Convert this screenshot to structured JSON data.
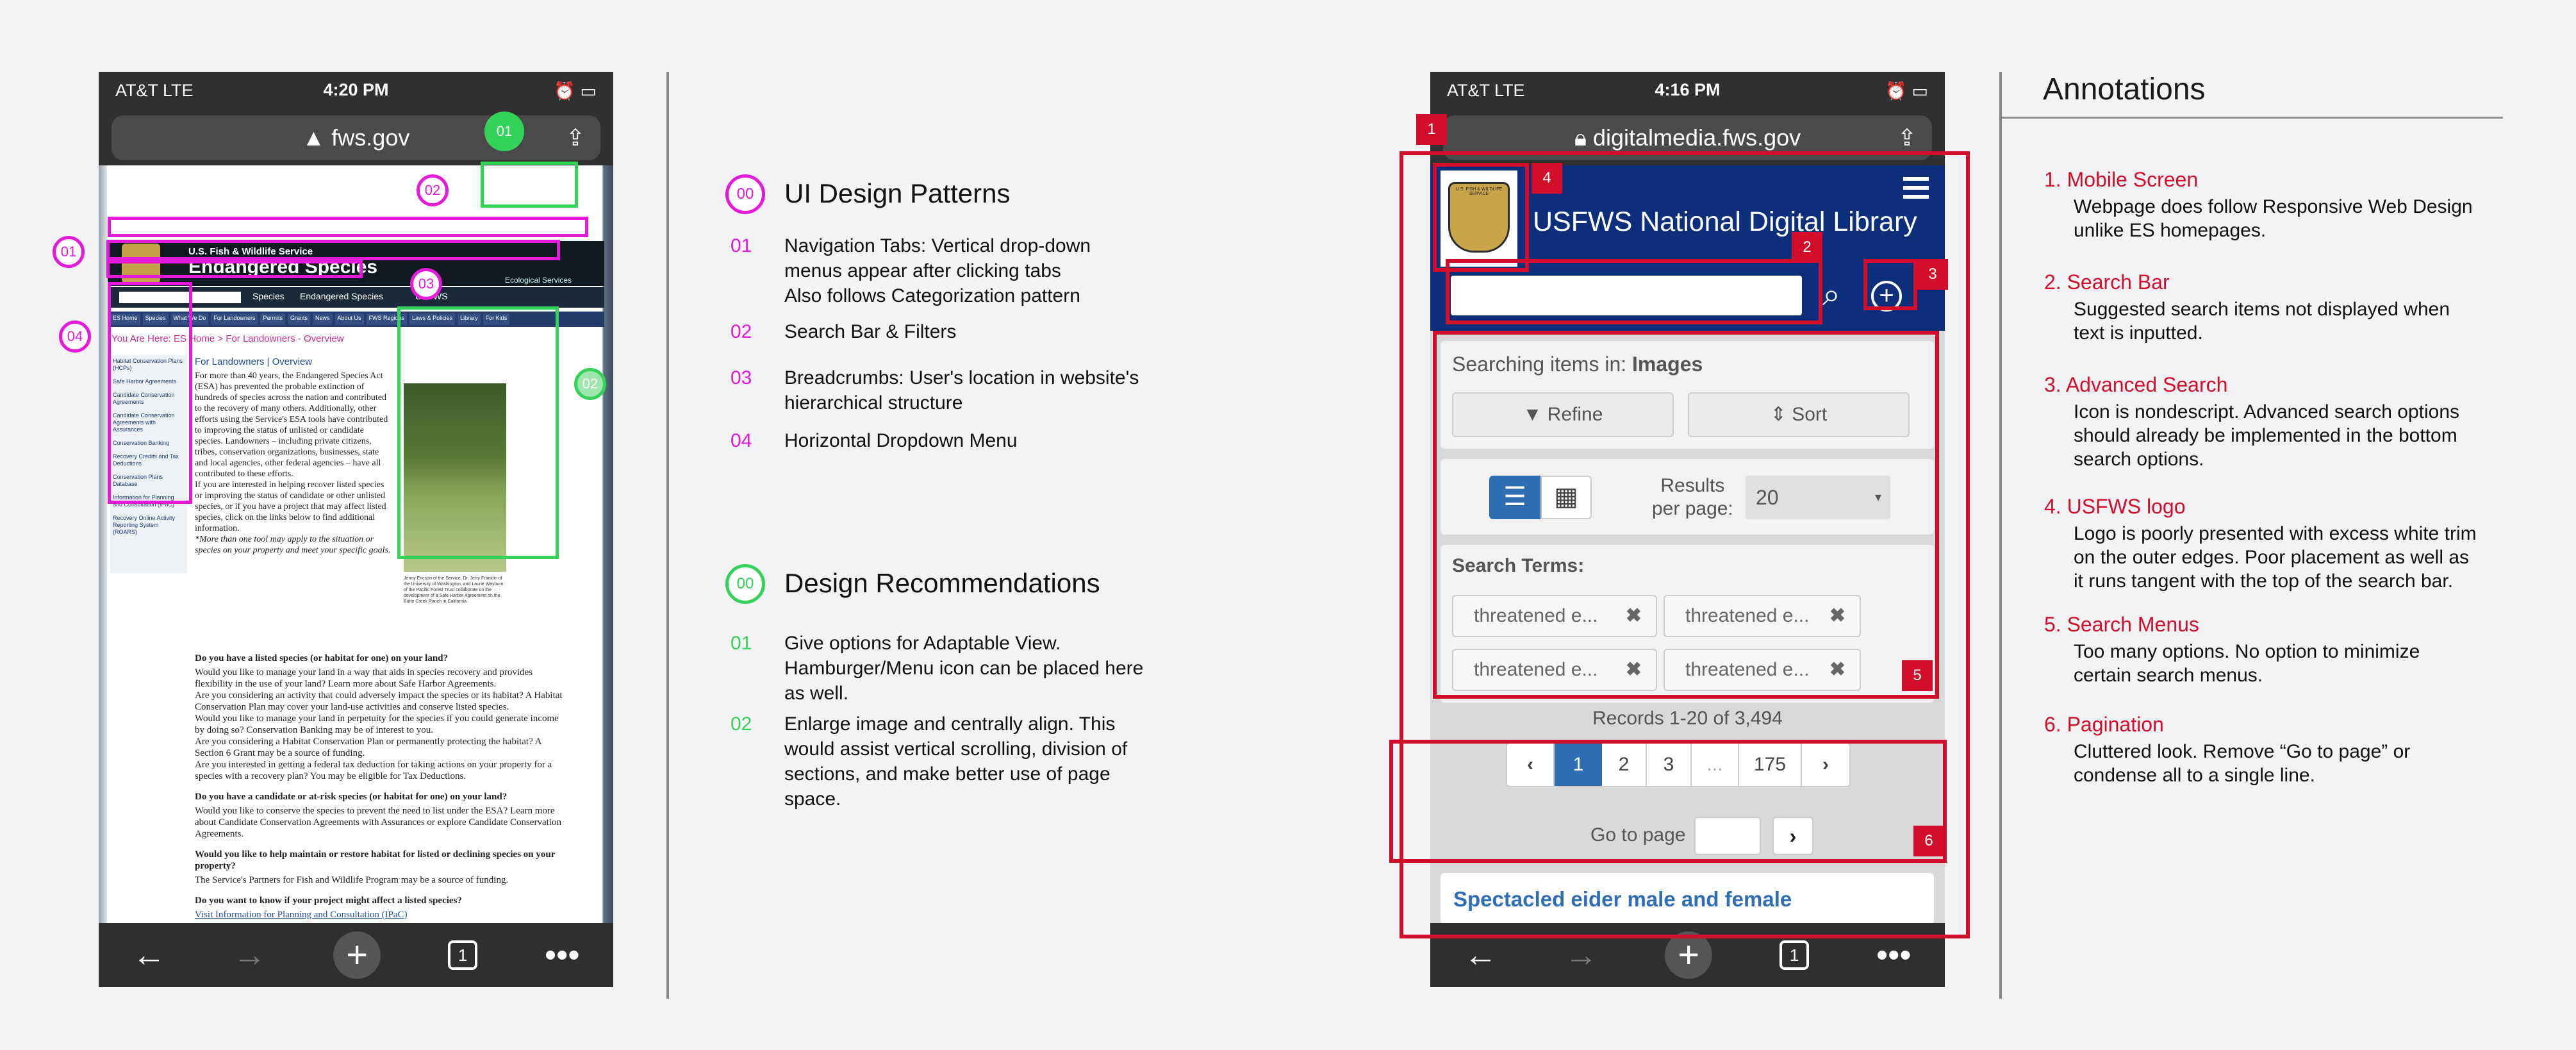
{
  "left_phone": {
    "carrier": "AT&T  LTE",
    "time": "4:20 PM",
    "url": "fws.gov",
    "banner_line1": "U.S. Fish & Wildlife Service",
    "banner_line2": "Endangered Species",
    "banner_right": "Ecological Services",
    "search_options": [
      "Species",
      "Endangered Species",
      "USFWS"
    ],
    "nav_tabs": [
      "ES Home",
      "Species",
      "What We Do",
      "For Landowners",
      "Permits",
      "Grants",
      "News",
      "About Us",
      "FWS Regions",
      "Laws & Policies",
      "Library",
      "For Kids"
    ],
    "breadcrumb": "You Are Here: ES Home > For Landowners - Overview",
    "sidebar_items": [
      "Habitat Conservation Plans (HCPs)",
      "Safe Harbor Agreements",
      "Candidate Conservation Agreements",
      "Candidate Conservation Agreements with Assurances",
      "Conservation Banking",
      "Recovery Credits and Tax Deductions",
      "Conservation Plans Database",
      "Information for Planning and Consultation (IPaC)",
      "Recovery Online Activity Reporting System (ROARS)"
    ],
    "page_heading": "For Landowners | Overview",
    "intro_1": "For more than 40 years, the Endangered Species Act (ESA) has prevented the probable extinction of hundreds of species across the nation and contributed to the recovery of many others. Additionally, other efforts using the Service's ESA tools have contributed to improving the status of unlisted or candidate species. Landowners – including private citizens, tribes, conservation organizations, businesses, state and local agencies, other federal agencies – have all contributed to these efforts.",
    "intro_2": "If you are interested in helping recover listed species or improving the status of candidate or other unlisted species, or if you have a project that may affect listed species, click on the links below to find additional information.",
    "intro_3": "*More than one tool may apply to the situation or species on your property and meet your specific goals.",
    "photo_caption": "Jenny Ericson of the Service, Dr. Jerry Franklin of the University of Washington, and Laurie Wayburn of the Pacific Forest Trust collaborate on the development of a Safe Harbor Agreement on the Butte Creek Ranch in California.",
    "q1": "Do you have a listed species (or habitat for one) on your land?",
    "a1": "Would you like to manage your land in a way that aids in species recovery and provides flexibility in the use of your land? Learn more about Safe Harbor Agreements.",
    "a1b": "Are you considering an activity that could adversely impact the species or its habitat? A Habitat Conservation Plan may cover your land-use activities and conserve listed species.",
    "a1c": "Would you like to manage your land in perpetuity for the species if you could generate income by doing so? Conservation Banking may be of interest to you.",
    "a1d": "Are you considering a Habitat Conservation Plan or permanently protecting the habitat? A Section 6 Grant may be a source of funding.",
    "a1e": "Are you interested in getting a federal tax deduction for taking actions on your property for a species with a recovery plan? You may be eligible for Tax Deductions.",
    "q2": "Do you have a candidate or at-risk species (or habitat for one) on your land?",
    "a2": "Would you like to conserve the species to prevent the need to list under the ESA? Learn more about Candidate Conservation Agreements with Assurances or explore Candidate Conservation Agreements.",
    "q3": "Would you like to help maintain or restore habitat for listed or declining species on your property?",
    "a3": "The Service's Partners for Fish and Wildlife Program may be a source of funding.",
    "q4": "Do you want to know if your project might affect a listed species?",
    "a4": "Visit Information for Planning and Consultation (IPaC)",
    "tab_count": "1"
  },
  "pins_left": {
    "top_green": "01",
    "top_magenta": "02",
    "left_01": "01",
    "left_04": "04",
    "mid_03": "03",
    "right_02": "02"
  },
  "patterns": {
    "pin": "00",
    "title": "UI Design Patterns",
    "items": [
      {
        "num": "01",
        "text_lines": [
          "Navigation Tabs: Vertical drop-down",
          "menus appear after clicking tabs",
          "Also follows Categorization pattern"
        ]
      },
      {
        "num": "02",
        "text_lines": [
          "Search Bar & Filters"
        ]
      },
      {
        "num": "03",
        "text_lines": [
          "Breadcrumbs:  User's location in website's",
          "hierarchical structure"
        ]
      },
      {
        "num": "04",
        "text_lines": [
          "Horizontal Dropdown Menu"
        ]
      }
    ]
  },
  "recommendations": {
    "pin": "00",
    "title": "Design Recommendations",
    "items": [
      {
        "num": "01",
        "text_lines": [
          "Give options for Adaptable View.",
          "Hamburger/Menu icon can be placed here",
          "as well."
        ]
      },
      {
        "num": "02",
        "text_lines": [
          "Enlarge image and centrally align.  This",
          "would assist vertical scrolling, division of",
          "sections, and make better use of page",
          "space."
        ]
      }
    ]
  },
  "right_phone": {
    "carrier": "AT&T  LTE",
    "time": "4:16 PM",
    "url": "digitalmedia.fws.gov",
    "logo_text": "U.S. FISH & WILDLIFE SERVICE",
    "site_title": "USFWS National Digital Library",
    "searching_prefix": "Searching items in: ",
    "searching_value": "Images",
    "refine_label": "Refine",
    "sort_label": "Sort",
    "results_label_1": "Results",
    "results_label_2": "per page:",
    "results_value": "20",
    "search_terms_label": "Search Terms:",
    "terms": [
      "threatened e...",
      "threatened e...",
      "threatened e...",
      "threatened e..."
    ],
    "records": "Records 1-20 of 3,494",
    "pages": [
      "1",
      "2",
      "3",
      "...",
      "175"
    ],
    "goto_label": "Go to page",
    "result_title": "Spectacled eider male and female",
    "tab_count": "1"
  },
  "red_tags": [
    "1",
    "2",
    "3",
    "4",
    "5",
    "6"
  ],
  "annotations": {
    "title": "Annotations",
    "items": [
      {
        "title": "1. Mobile Screen",
        "body": [
          "Webpage does follow Responsive Web Design",
          "unlike ES homepages."
        ]
      },
      {
        "title": "2. Search Bar",
        "body": [
          "Suggested search items not displayed when",
          "text is inputted."
        ]
      },
      {
        "title": "3. Advanced Search",
        "body": [
          "Icon is nondescript.  Advanced search options",
          "should already be implemented in the bottom",
          "search options."
        ]
      },
      {
        "title": "4. USFWS logo",
        "body": [
          "Logo is poorly presented with excess white trim",
          "on the outer edges.  Poor placement as well as",
          "it runs tangent with the top of the search bar."
        ]
      },
      {
        "title": "5. Search Menus",
        "body": [
          "Too many options.  No option to minimize",
          "certain search menus."
        ]
      },
      {
        "title": "6. Pagination",
        "body": [
          "Cluttered look.  Remove “Go to page” or",
          "condense all to a single line."
        ]
      }
    ]
  },
  "colors": {
    "magenta": "#e419d9",
    "green": "#35d25a",
    "red": "#d30e2b",
    "fws_blue": "#0d2e7a"
  }
}
